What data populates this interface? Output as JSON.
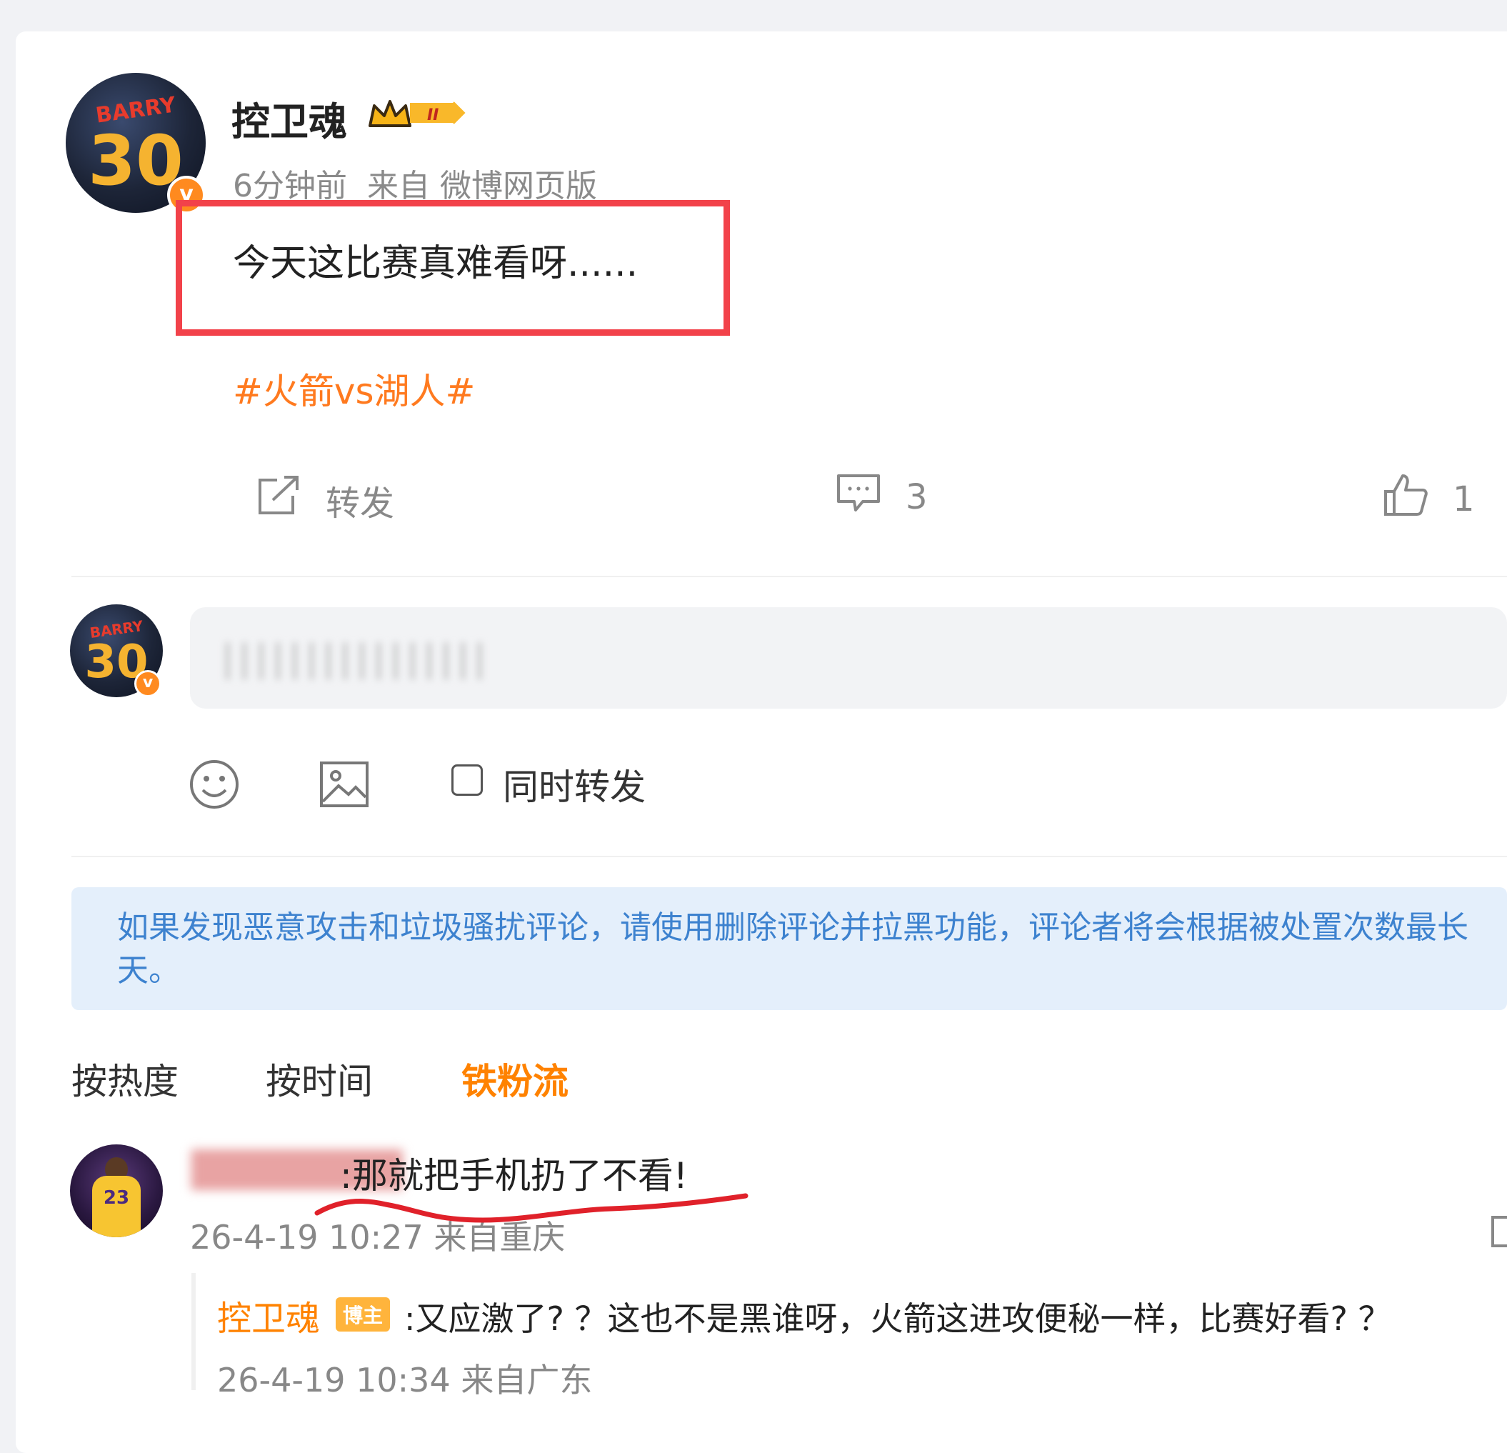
{
  "post": {
    "username": "控卫魂",
    "level_badge": "II",
    "meta": "6分钟前  来自 微博网页版",
    "text": "今天这比赛真难看呀......",
    "topic": "#火箭vs湖人#",
    "avatar": {
      "jersey_name": "BARRY",
      "jersey_number": "30",
      "verified_badge": "v"
    }
  },
  "actions": {
    "repost_label": "转发",
    "comment_count": "3",
    "like_count": "1"
  },
  "composer": {
    "placeholder": "||||||||||||||||",
    "repost_checkbox_label": "同时转发",
    "avatar": {
      "jersey_name": "BARRY",
      "jersey_number": "30",
      "verified_badge": "v"
    }
  },
  "notice": {
    "line1": "如果发现恶意攻击和垃圾骚扰评论，请使用删除评论并拉黑功能，评论者将会根据被处置次数最长",
    "line2": "天。"
  },
  "sort_tabs": [
    {
      "label": "按热度"
    },
    {
      "label": "按时间"
    },
    {
      "label": "铁粉流"
    }
  ],
  "comment": {
    "username_blurred": "████████",
    "text": ":那就把手机扔了不看!",
    "meta": "26-4-19 10:27 来自重庆",
    "avatar_number": "23"
  },
  "reply": {
    "username": "控卫魂",
    "host_badge": "博主",
    "text": ":又应激了? ？这也不是黑谁呀，火箭这进攻便秘一样，比赛好看? ？",
    "meta": "26-4-19 10:34 来自广东"
  },
  "colors": {
    "accent_orange": "#ff8200",
    "topic_orange": "#ff7a1f",
    "highlight_red": "#f2424a",
    "notice_bg": "#e4effb",
    "notice_text": "#3d82cf"
  }
}
